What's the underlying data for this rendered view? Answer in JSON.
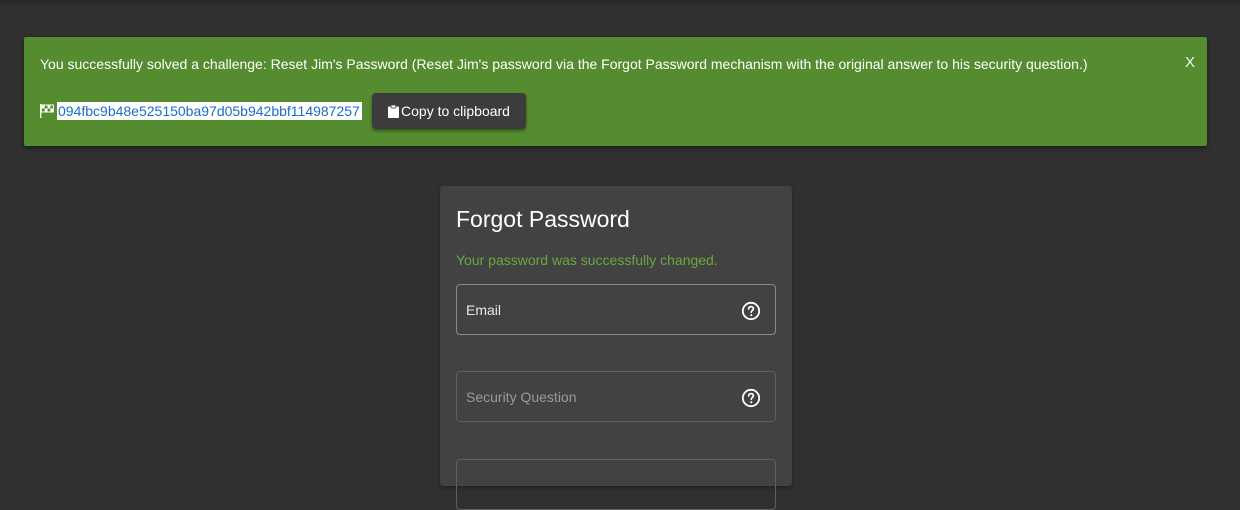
{
  "banner": {
    "message": "You successfully solved a challenge: Reset Jim's Password (Reset Jim's password via the Forgot Password mechanism with the original answer to his security question.)",
    "close_label": "X",
    "flag_code": "094fbc9b48e525150ba97d05b942bbf114987257",
    "copy_label": "Copy to clipboard",
    "color": "#548c2f"
  },
  "card": {
    "title": "Forgot Password",
    "success_message": "Your password was successfully changed.",
    "fields": [
      {
        "label": "Email",
        "icon": "help-circle-icon"
      },
      {
        "label": "Security Question",
        "icon": "help-circle-icon"
      }
    ]
  },
  "colors": {
    "background": "#303030",
    "card": "#424242",
    "success_text": "#6aa83f",
    "link": "#1a6dc9"
  }
}
